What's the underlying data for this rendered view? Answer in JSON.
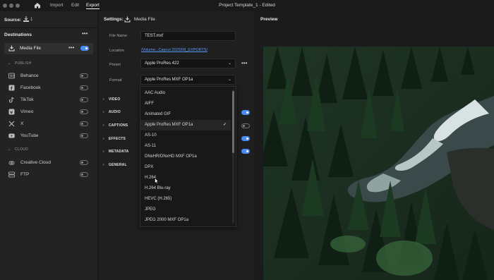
{
  "topbar": {
    "nav": [
      "Import",
      "Edit",
      "Export"
    ],
    "active": "Export",
    "title": "Project Template_1 - Edited"
  },
  "source": {
    "label": "Source:",
    "count": "1"
  },
  "destinations": {
    "title": "Destinations",
    "media_file": {
      "label": "Media File",
      "enabled": true
    },
    "publish_heading": "PUBLISH",
    "publish_items": [
      {
        "label": "Behance",
        "icon": "behance-icon"
      },
      {
        "label": "Facebook",
        "icon": "facebook-icon"
      },
      {
        "label": "TikTok",
        "icon": "tiktok-icon"
      },
      {
        "label": "Vimeo",
        "icon": "vimeo-icon"
      },
      {
        "label": "X",
        "icon": "x-icon"
      },
      {
        "label": "YouTube",
        "icon": "youtube-icon"
      }
    ],
    "cloud_heading": "CLOUD",
    "cloud_items": [
      {
        "label": "Creative Cloud",
        "icon": "creative-cloud-icon"
      },
      {
        "label": "FTP",
        "icon": "ftp-icon"
      }
    ]
  },
  "settings": {
    "title": "Settings:",
    "name": "Media File",
    "file_name_label": "File Name",
    "file_name": "TEST.mxf",
    "location_label": "Location",
    "location": "/Volume...Capcut 2025/08_EXPORTS/",
    "preset_label": "Preset",
    "preset": "Apple ProRes 422",
    "format_label": "Format",
    "format": "Apple ProRes MXF OP1a",
    "sections": [
      "VIDEO",
      "AUDIO",
      "CAPTIONS",
      "EFFECTS",
      "METADATA",
      "GENERAL"
    ],
    "section_toggles": {
      "VIDEO": true,
      "AUDIO": true,
      "CAPTIONS": false,
      "EFFECTS": true,
      "METADATA": true
    }
  },
  "format_dropdown": {
    "options": [
      "AAC Audio",
      "AIFF",
      "Animated GIF",
      "Apple ProRes MXF OP1a",
      "AS-10",
      "AS-11",
      "DNxHR/DNxHD MXF OP1a",
      "DPX",
      "H.264",
      "H.264 Blu-ray",
      "HEVC (H.265)",
      "JPEG",
      "JPEG 2000 MXF OP1a"
    ],
    "selected": "Apple ProRes MXF OP1a"
  },
  "preview": {
    "title": "Preview"
  },
  "colors": {
    "accent": "#4a8cf2",
    "link": "#5a9bff"
  }
}
